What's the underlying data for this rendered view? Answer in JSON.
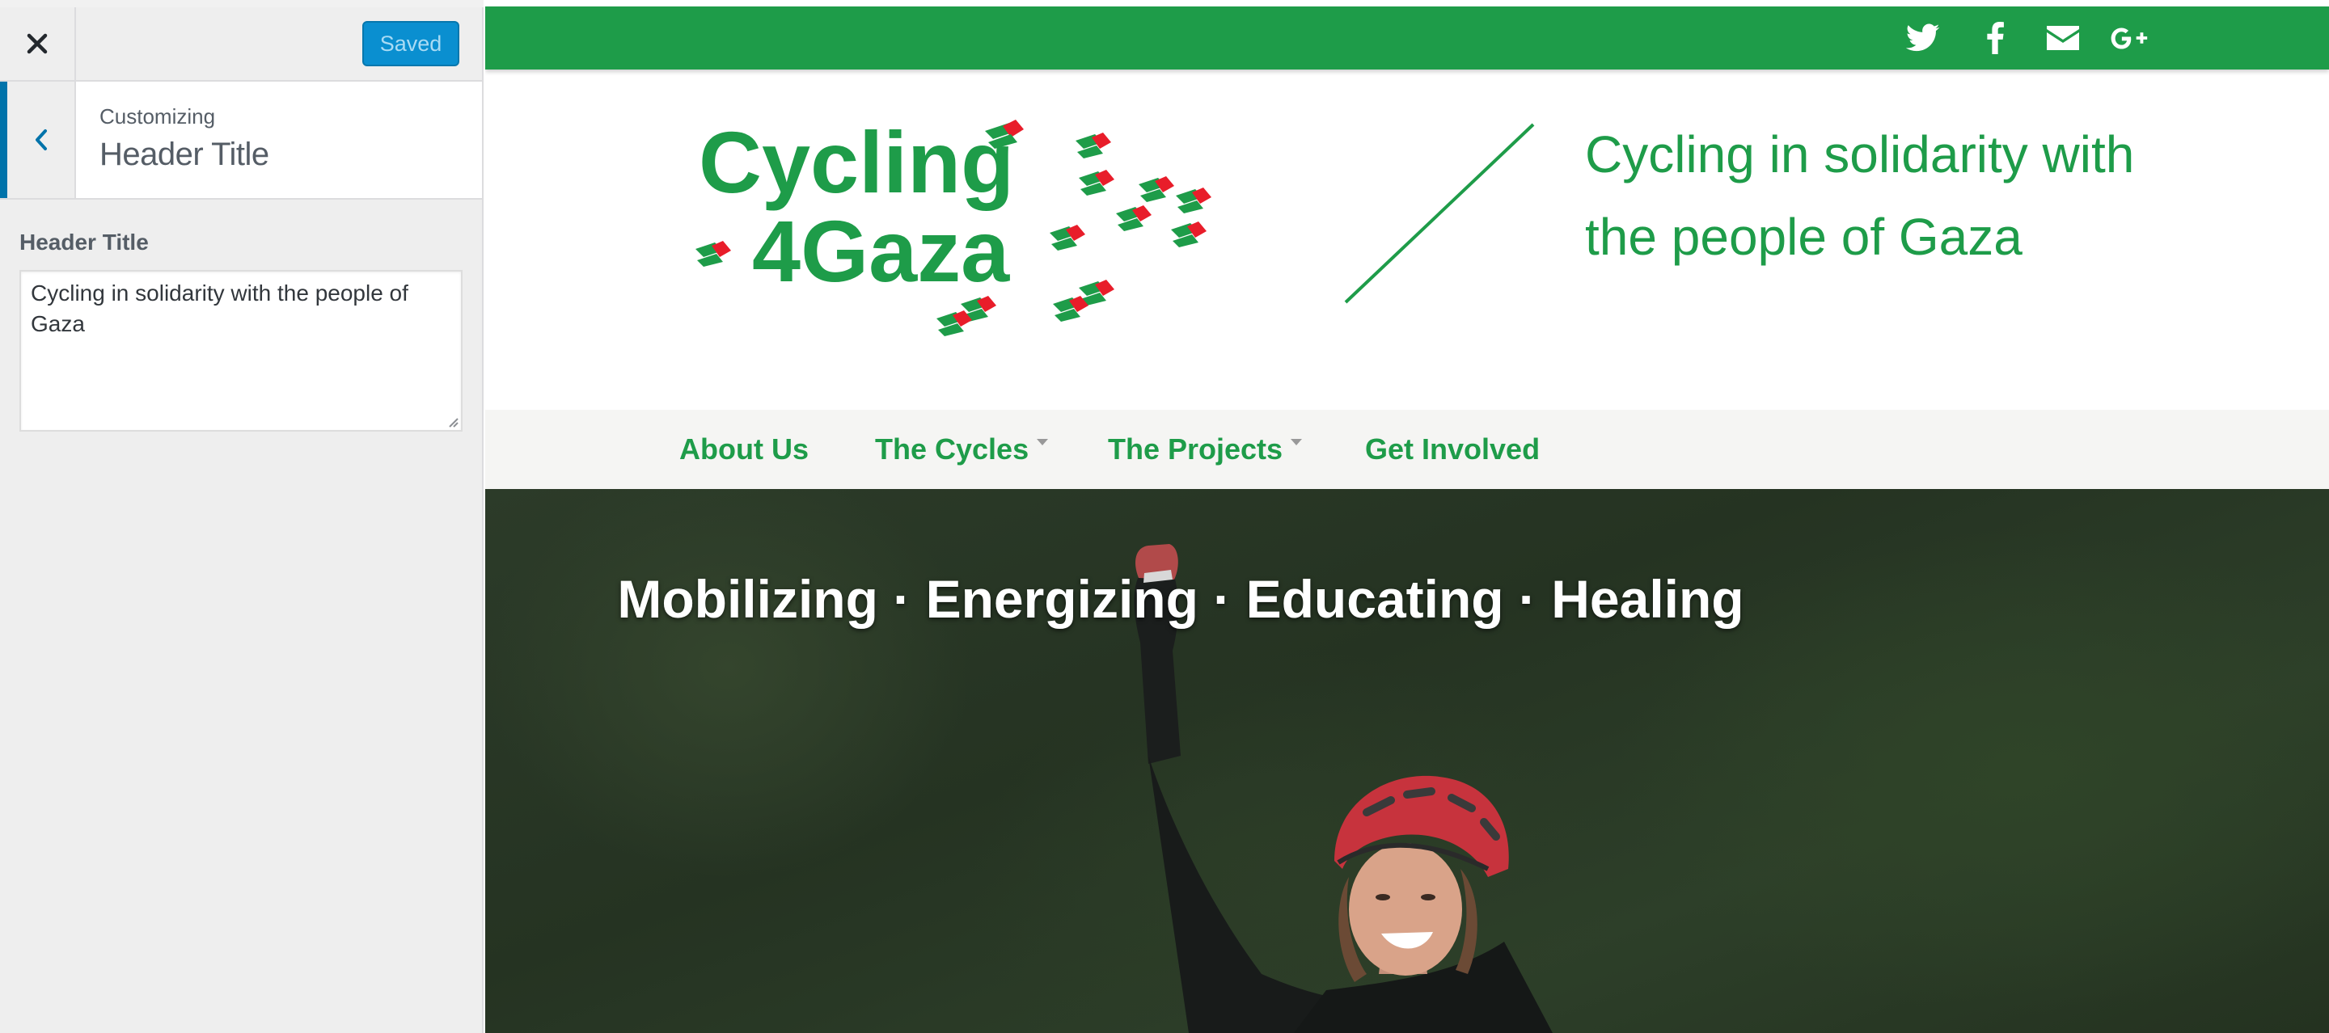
{
  "sidebar": {
    "saved_label": "Saved",
    "breadcrumb": "Customizing",
    "section_title": "Header Title",
    "field_label": "Header Title",
    "field_value": "Cycling in solidarity with the people of Gaza"
  },
  "site": {
    "brand_color": "#1e9c49",
    "social_icons": [
      "twitter-icon",
      "facebook-icon",
      "envelope-icon",
      "google-plus-icon"
    ],
    "logo": {
      "line1": "Cycling",
      "line2": "4Gaza"
    },
    "tagline": "Cycling in solidarity with the people of Gaza",
    "nav": [
      {
        "label": "About Us",
        "has_dropdown": false
      },
      {
        "label": "The Cycles",
        "has_dropdown": true
      },
      {
        "label": "The Projects",
        "has_dropdown": true
      },
      {
        "label": "Get Involved",
        "has_dropdown": false
      }
    ],
    "hero_text": "Mobilizing · Energizing · Educating · Healing"
  }
}
